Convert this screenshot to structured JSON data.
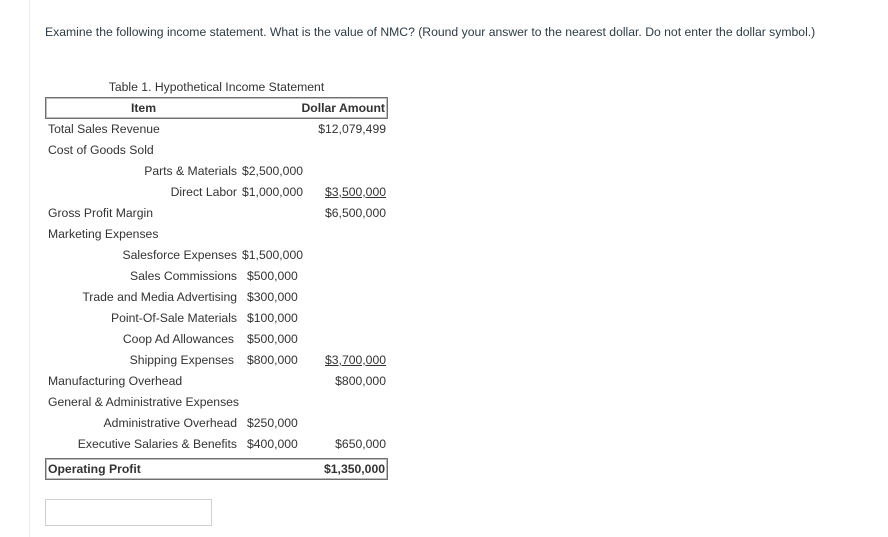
{
  "question": "Examine the following income statement.  What is the value of NMC? (Round your answer to the nearest dollar.  Do not enter the dollar symbol.)",
  "table": {
    "caption": "Table 1. Hypothetical Income Statement",
    "headers": {
      "item": "Item",
      "amount": "Dollar Amount"
    },
    "rows": [
      {
        "label": "Total Sales Revenue",
        "amount": "$12,079,499"
      },
      {
        "label": "Cost of Goods Sold"
      },
      {
        "sublabel": "Parts & Materials",
        "subamount": "$2,500,000"
      },
      {
        "sublabel": "Direct Labor",
        "subamount": "$1,000,000",
        "amount": "$3,500,000"
      },
      {
        "label": "Gross Profit Margin",
        "amount": "$6,500,000"
      },
      {
        "label": "Marketing Expenses"
      },
      {
        "sublabel": "Salesforce Expenses",
        "subamount": "$1,500,000"
      },
      {
        "sublabel": "Sales Commissions",
        "subamount": "$500,000"
      },
      {
        "sublabel": "Trade and Media Advertising",
        "subamount": "$300,000"
      },
      {
        "sublabel": "Point-Of-Sale Materials",
        "subamount": "$100,000"
      },
      {
        "sublabel": "Coop Ad Allowances",
        "subamount": "$500,000"
      },
      {
        "sublabel": "Shipping Expenses",
        "subamount": "$800,000",
        "amount": "$3,700,000"
      },
      {
        "label": "Manufacturing Overhead",
        "amount": "$800,000"
      },
      {
        "label": "General & Administrative Expenses"
      },
      {
        "sublabel": "Administrative Overhead",
        "subamount": "$250,000"
      },
      {
        "sublabel": "Executive Salaries & Benefits",
        "subamount": "$400,000",
        "amount": "$650,000"
      }
    ],
    "total": {
      "label": "Operating Profit",
      "amount": "$1,350,000"
    }
  },
  "answer": {
    "value": "",
    "placeholder": ""
  }
}
